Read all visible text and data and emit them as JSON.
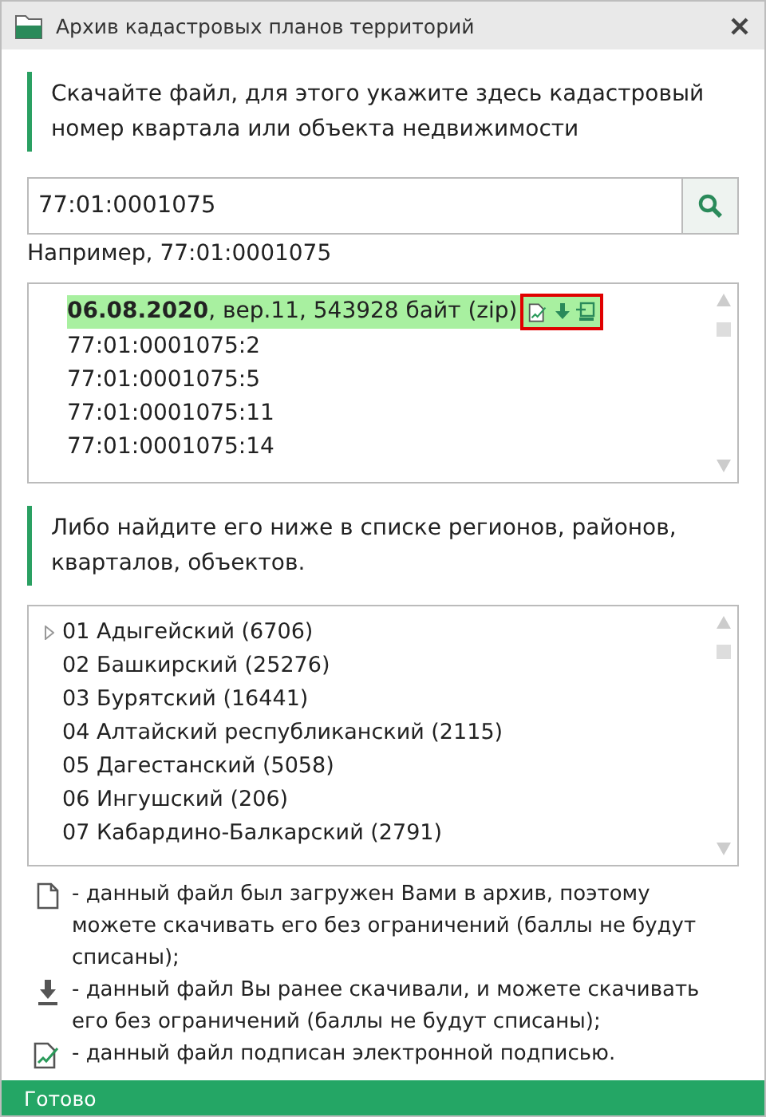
{
  "window": {
    "title": "Архив кадастровых планов территорий"
  },
  "intro": "Скачайте файл, для этого укажите здесь кадастровый номер квартала или объекта недвижимости",
  "search": {
    "value": "77:01:0001075"
  },
  "example": "Например, 77:01:0001075",
  "files": {
    "version": {
      "date": "06.08.2020",
      "info": ", вер.11, 543928 байт (zip)",
      "selected": true,
      "icons": [
        {
          "kind": "signed"
        },
        {
          "kind": "download"
        },
        {
          "kind": "xml"
        }
      ],
      "marked": true
    },
    "items": [
      "77:01:0001075:2",
      "77:01:0001075:5",
      "77:01:0001075:11",
      "77:01:0001075:14"
    ]
  },
  "hint": "Либо найдите его ниже в списке регионов, районов, кварталов, объектов.",
  "regions": [
    {
      "label": "01 Адыгейский (6706)",
      "expandable": true
    },
    {
      "label": "02 Башкирский (25276)",
      "expandable": false
    },
    {
      "label": "03 Бурятский (16441)",
      "expandable": false
    },
    {
      "label": "04 Алтайский республиканский (2115)",
      "expandable": false
    },
    {
      "label": "05 Дагестанский (5058)",
      "expandable": false
    },
    {
      "label": "06 Ингушский (206)",
      "expandable": false
    },
    {
      "label": "07 Кабардино-Балкарский (2791)",
      "expandable": false
    }
  ],
  "legend": [
    {
      "kind": "file",
      "text": "- данный файл был загружен Вами в архив, поэтому можете скачивать его без ограничений (баллы не будут списаны);"
    },
    {
      "kind": "download",
      "text": "- данный файл Вы ранее скачивали, и можете скачивать его без ограничений (баллы не будут списаны);"
    },
    {
      "kind": "signed",
      "text": "- данный файл подписан электронной подписью."
    }
  ],
  "status_bar": "Готово"
}
